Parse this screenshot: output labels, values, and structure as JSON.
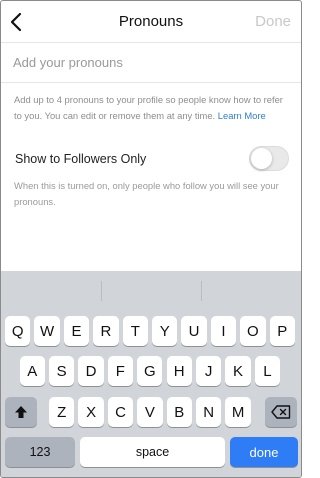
{
  "header": {
    "title": "Pronouns",
    "done_label": "Done",
    "back_icon": "chevron-left-icon"
  },
  "input": {
    "placeholder": "Add your pronouns",
    "value": ""
  },
  "help": {
    "text": "Add up to 4 pronouns to your profile so people know how to refer to you. You can edit or remove them at any time.",
    "learn_more": "Learn More"
  },
  "followers_toggle": {
    "label": "Show to Followers Only",
    "on": false,
    "help": "When this is turned on, only people who follow you will see your pronouns."
  },
  "keyboard": {
    "row1": [
      "Q",
      "W",
      "E",
      "R",
      "T",
      "Y",
      "U",
      "I",
      "O",
      "P"
    ],
    "row2": [
      "A",
      "S",
      "D",
      "F",
      "G",
      "H",
      "J",
      "K",
      "L"
    ],
    "row3": [
      "Z",
      "X",
      "C",
      "V",
      "B",
      "N",
      "M"
    ],
    "numbers_label": "123",
    "space_label": "space",
    "done_label": "done",
    "shift_icon": "shift-icon",
    "delete_icon": "backspace-icon",
    "colors": {
      "background": "#d1d4d9",
      "key": "#ffffff",
      "dark_key": "#adb3bc",
      "done": "#2e7cf6"
    }
  },
  "colors": {
    "link": "#2f7dd6",
    "muted": "#8e8e8e",
    "disabled": "#c8c8c8"
  }
}
